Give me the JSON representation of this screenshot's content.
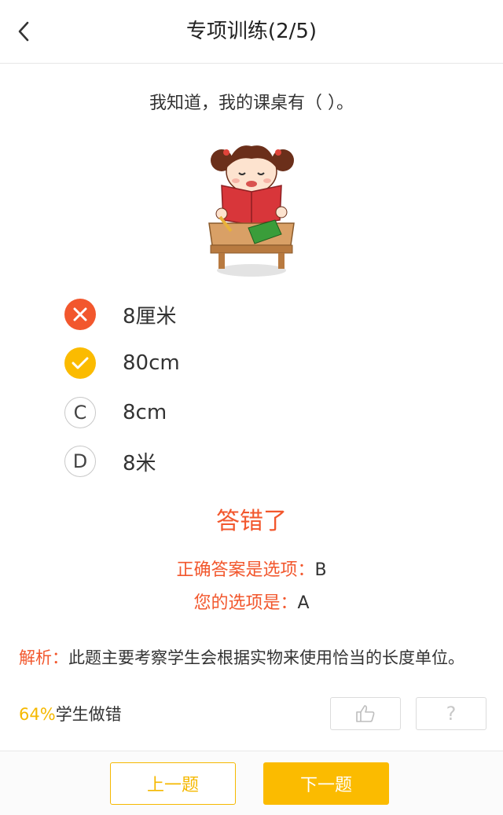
{
  "header": {
    "title": "专项训练(2/5)",
    "back_icon": "chevron-left-icon"
  },
  "question": {
    "text": "我知道，我的课桌有（    ）。"
  },
  "options": [
    {
      "mark": "",
      "state": "wrong",
      "text": "8厘米"
    },
    {
      "mark": "",
      "state": "correct",
      "text": "80cm"
    },
    {
      "mark": "C",
      "state": "normal",
      "text": "8cm"
    },
    {
      "mark": "D",
      "state": "normal",
      "text": "8米"
    }
  ],
  "colors": {
    "wrong": "#f2572d",
    "correct": "#fbbb00",
    "accent": "#f5b800"
  },
  "result": {
    "title": "答错了",
    "correct_label": "正确答案是选项：",
    "correct_value": "B",
    "yours_label": "您的选项是：",
    "yours_value": "A"
  },
  "analysis": {
    "label": "解析：",
    "text": "此题主要考察学生会根据实物来使用恰当的长度单位。"
  },
  "stats": {
    "percent": "64%",
    "suffix": "学生做错"
  },
  "actions": {
    "like_icon": "thumbs-up-icon",
    "help": "?"
  },
  "footer": {
    "prev": "上一题",
    "next": "下一题"
  }
}
